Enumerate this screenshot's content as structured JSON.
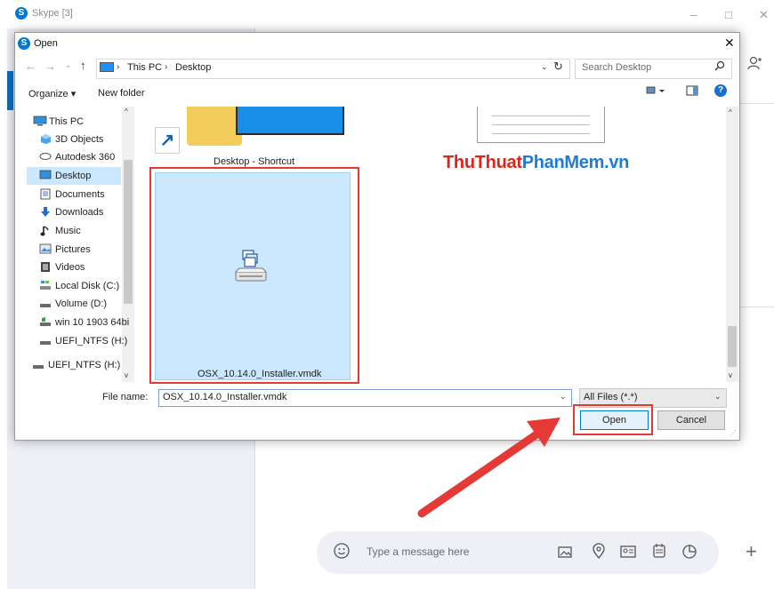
{
  "skype": {
    "title": "Skype [3]",
    "logo_letter": "S",
    "minimize": "–",
    "maximize": "□",
    "close": "✕",
    "add_contact_icon": "person-add-icon",
    "message_placeholder": "Type a message here",
    "plus": "+"
  },
  "dialog": {
    "title": "Open",
    "close": "✕",
    "address": {
      "this_pc": "This PC",
      "desktop": "Desktop",
      "separator": "›"
    },
    "search_placeholder": "Search Desktop",
    "toolbar": {
      "organize": "Organize ▾",
      "new_folder": "New folder"
    },
    "nav_items": [
      {
        "label": "This PC",
        "icon": "pc-icon"
      },
      {
        "label": "3D Objects",
        "icon": "cube-icon"
      },
      {
        "label": "Autodesk 360",
        "icon": "cloud-icon"
      },
      {
        "label": "Desktop",
        "icon": "desktop-icon",
        "selected": true
      },
      {
        "label": "Documents",
        "icon": "document-icon"
      },
      {
        "label": "Downloads",
        "icon": "download-icon"
      },
      {
        "label": "Music",
        "icon": "music-icon"
      },
      {
        "label": "Pictures",
        "icon": "picture-icon"
      },
      {
        "label": "Videos",
        "icon": "video-icon"
      },
      {
        "label": "Local Disk (C:)",
        "icon": "drive-icon"
      },
      {
        "label": "Volume (D:)",
        "icon": "drive-icon"
      },
      {
        "label": "win 10 1903 64bi",
        "icon": "drive-icon"
      },
      {
        "label": "UEFI_NTFS (H:)",
        "icon": "drive-icon"
      },
      {
        "label": "UEFI_NTFS (H:)",
        "icon": "drive-icon"
      }
    ],
    "files": {
      "desktop_shortcut": "Desktop - Shortcut",
      "selected_file": "OSX_10.14.0_Installer.vmdk"
    },
    "file_name_label": "File name:",
    "file_name_value": "OSX_10.14.0_Installer.vmdk",
    "filter_value": "All Files (*.*)",
    "open_label": "Open",
    "cancel_label": "Cancel"
  },
  "watermark": {
    "part1": "Thu",
    "part2": "Thuat",
    "part3": "Phan",
    "part4": "Mem.vn"
  },
  "colors": {
    "accent": "#0078d7",
    "highlight_red": "#e53935",
    "selection": "#cce8ff"
  }
}
